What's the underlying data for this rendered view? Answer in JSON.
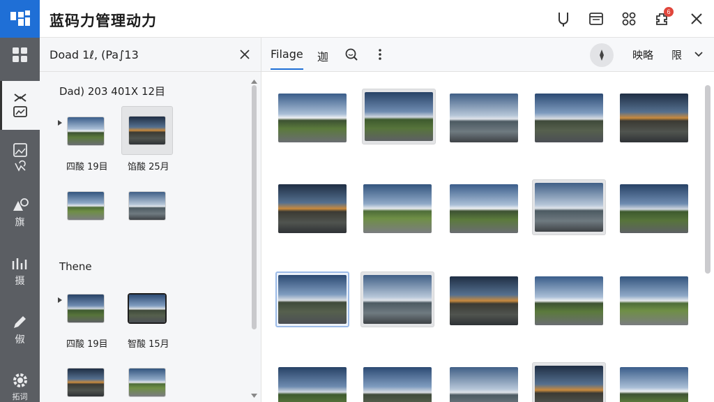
{
  "app": {
    "title": "蓝码力管理动力",
    "brand_color": "#1f6fd6"
  },
  "titlebar": {
    "icons": [
      "magnet-icon",
      "window-icon",
      "modules-icon",
      "plugin-icon",
      "close-icon"
    ],
    "notification_count": "6"
  },
  "rail": {
    "items": [
      {
        "icon": "dashboard-icon",
        "label": ""
      },
      {
        "icon": "transfer-image-icon",
        "label": ""
      },
      {
        "icon": "image-icon",
        "label": ""
      },
      {
        "icon": "shapes-icon",
        "label": "旗"
      },
      {
        "icon": "chart-icon",
        "label": "摄"
      },
      {
        "icon": "pencil-icon",
        "label": "俶"
      },
      {
        "icon": "settings-icon",
        "label": "拓词"
      }
    ]
  },
  "side": {
    "title": "Doad 1ℓ, (Pa∫13",
    "group1": {
      "title": "Dad) 203 401X 12目",
      "captions": [
        "四酸 19目",
        "馅酸 25月"
      ]
    },
    "group2": {
      "title": "Thene",
      "captions": [
        "四酸 19目",
        "智酸 15月"
      ]
    }
  },
  "main": {
    "tabs": [
      {
        "label": "Filage"
      },
      {
        "label": "迦"
      }
    ],
    "right_labels": [
      "映略",
      "限"
    ]
  }
}
